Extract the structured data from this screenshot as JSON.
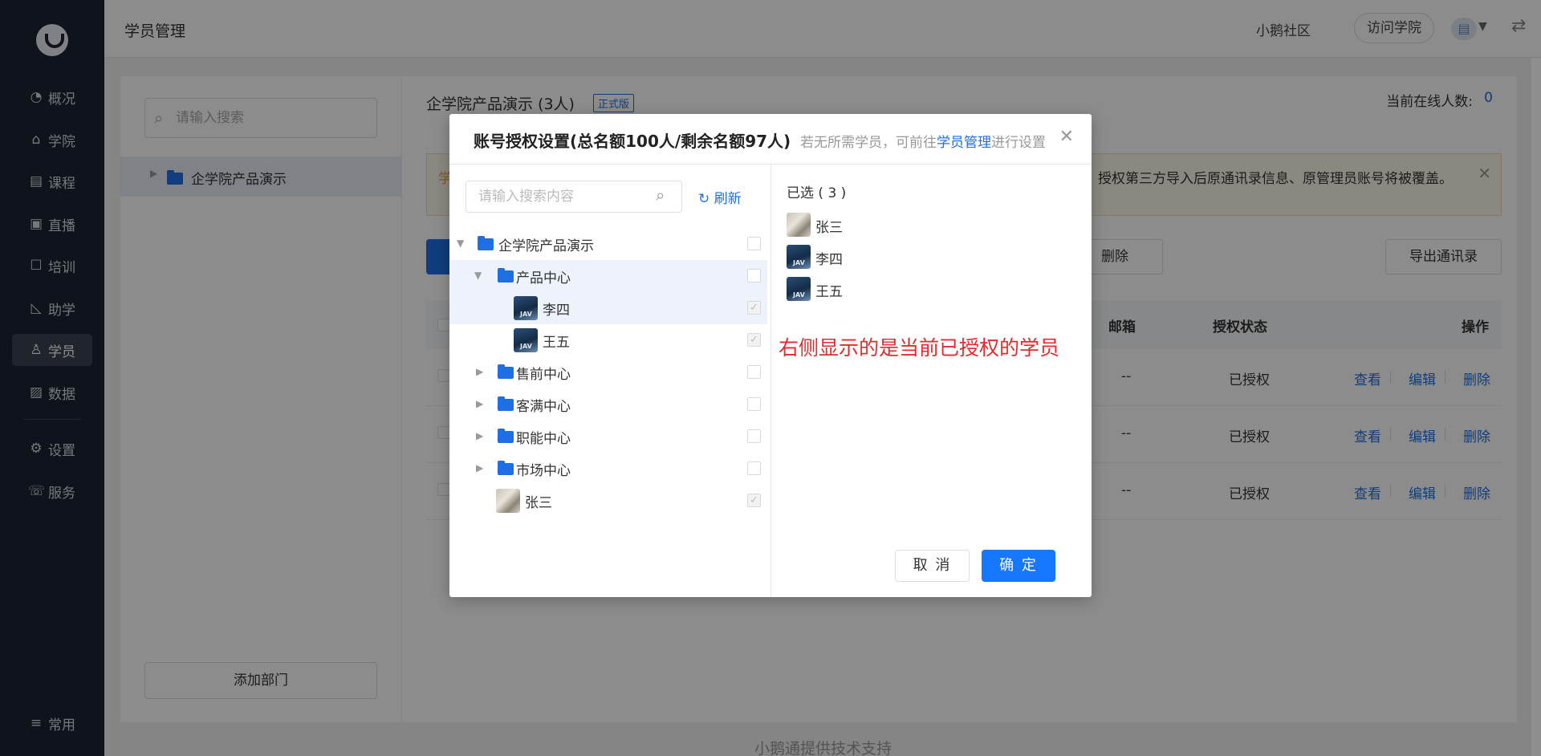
{
  "sidebar": {
    "items": [
      {
        "label": "概况",
        "icon": "pie-chart-icon"
      },
      {
        "label": "学院",
        "icon": "academy-icon"
      },
      {
        "label": "课程",
        "icon": "book-icon"
      },
      {
        "label": "直播",
        "icon": "live-icon"
      },
      {
        "label": "培训",
        "icon": "training-icon"
      },
      {
        "label": "助学",
        "icon": "ruler-icon"
      },
      {
        "label": "学员",
        "icon": "user-icon"
      },
      {
        "label": "数据",
        "icon": "chart-icon"
      },
      {
        "label": "设置",
        "icon": "gear-icon"
      },
      {
        "label": "服务",
        "icon": "service-icon"
      }
    ],
    "bottom_item": "常用",
    "active": "学员"
  },
  "header": {
    "title": "学员管理",
    "community": "小鹅社区",
    "visit_button": "访问学院"
  },
  "dept_panel": {
    "search_placeholder": "请输入搜索",
    "root_label": "企学院产品演示",
    "add_button": "添加部门"
  },
  "main": {
    "org_title": "企学院产品演示 (3人)",
    "edition_badge": "正式版",
    "online_label": "当前在线人数:",
    "online_count": "0",
    "notice_start": "学",
    "notice_text": "授权第三方导入后原通讯录信息、原管理员账号将被覆盖。",
    "delete_button": "删除",
    "export_button": "导出通讯录",
    "table_headers": {
      "email": "邮箱",
      "auth": "授权状态",
      "ops": "操作"
    },
    "rows": [
      {
        "email": "--",
        "status": "已授权",
        "view": "查看",
        "edit": "编辑",
        "delete": "删除"
      },
      {
        "email": "--",
        "status": "已授权",
        "view": "查看",
        "edit": "编辑",
        "delete": "删除"
      },
      {
        "email": "--",
        "status": "已授权",
        "view": "查看",
        "edit": "编辑",
        "delete": "删除"
      }
    ],
    "footer": "小鹅通提供技术支持"
  },
  "modal": {
    "title": "账号授权设置(总名额100人/剩余名额97人)",
    "hint_prefix": "若无所需学员，可前往",
    "hint_link": "学员管理",
    "hint_suffix": "进行设置",
    "search_placeholder": "请输入搜索内容",
    "refresh": "刷新",
    "tree": [
      {
        "label": "企学院产品演示",
        "type": "folder",
        "level": 0,
        "expanded": true,
        "checked": false
      },
      {
        "label": "产品中心",
        "type": "folder",
        "level": 1,
        "expanded": true,
        "checked": false
      },
      {
        "label": "李四",
        "type": "user",
        "level": 2,
        "checked": true,
        "avatar": "team"
      },
      {
        "label": "王五",
        "type": "user",
        "level": 2,
        "checked": true,
        "avatar": "team"
      },
      {
        "label": "售前中心",
        "type": "folder",
        "level": 1,
        "expanded": false,
        "checked": false
      },
      {
        "label": "客满中心",
        "type": "folder",
        "level": 1,
        "expanded": false,
        "checked": false
      },
      {
        "label": "职能中心",
        "type": "folder",
        "level": 1,
        "expanded": false,
        "checked": false
      },
      {
        "label": "市场中心",
        "type": "folder",
        "level": 1,
        "expanded": false,
        "checked": false
      },
      {
        "label": "张三",
        "type": "user",
        "level": 1,
        "checked": true,
        "avatar": "cat"
      }
    ],
    "selected_title": "已选 ( 3 )",
    "selected": [
      {
        "name": "张三",
        "avatar": "cat"
      },
      {
        "name": "李四",
        "avatar": "team"
      },
      {
        "name": "王五",
        "avatar": "team"
      }
    ],
    "annotation": "右侧显示的是当前已授权的学员",
    "cancel": "取 消",
    "confirm": "确 定"
  },
  "colors": {
    "primary": "#1677ff",
    "sidebar": "#1b2333",
    "annotation": "#e52b2b"
  }
}
